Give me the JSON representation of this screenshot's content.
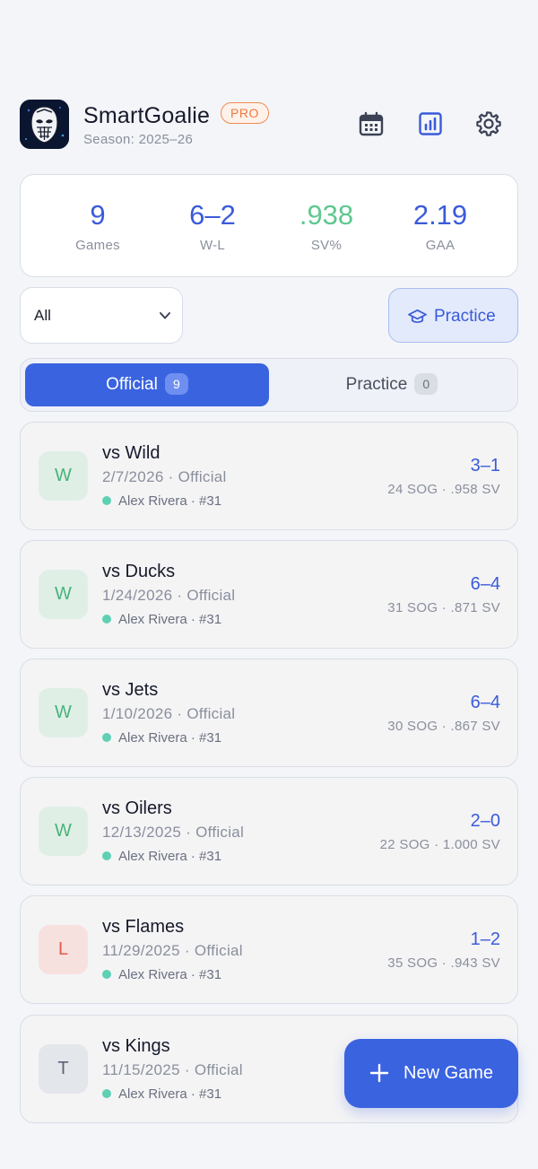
{
  "header": {
    "app_name": "SmartGoalie",
    "badge": "PRO",
    "season": "Season: 2025–26",
    "icons": [
      "calendar-icon",
      "bar-chart-icon",
      "gear-icon"
    ]
  },
  "stats": [
    {
      "value": "9",
      "label": "Games",
      "color": "#3a5bd9"
    },
    {
      "value": "6–2",
      "label": "W-L",
      "color": "#3a5bd9"
    },
    {
      "value": ".938",
      "label": "SV%",
      "color": "#5ec88f"
    },
    {
      "value": "2.19",
      "label": "GAA",
      "color": "#3a5bd9"
    }
  ],
  "filter": {
    "selected": "All",
    "practice_button": "Practice"
  },
  "tabs": [
    {
      "label": "Official",
      "count": "9",
      "active": true
    },
    {
      "label": "Practice",
      "count": "0",
      "active": false
    }
  ],
  "games": [
    {
      "result": "W",
      "opponent": "vs Wild",
      "meta": "2/7/2026 · Official",
      "goalie": "Alex Rivera · #31",
      "score": "3–1",
      "shots": "24 SOG · .958 SV"
    },
    {
      "result": "W",
      "opponent": "vs Ducks",
      "meta": "1/24/2026 · Official",
      "goalie": "Alex Rivera · #31",
      "score": "6–4",
      "shots": "31 SOG · .871 SV"
    },
    {
      "result": "W",
      "opponent": "vs Jets",
      "meta": "1/10/2026 · Official",
      "goalie": "Alex Rivera · #31",
      "score": "6–4",
      "shots": "30 SOG · .867 SV"
    },
    {
      "result": "W",
      "opponent": "vs Oilers",
      "meta": "12/13/2025 · Official",
      "goalie": "Alex Rivera · #31",
      "score": "2–0",
      "shots": "22 SOG · 1.000 SV"
    },
    {
      "result": "L",
      "opponent": "vs Flames",
      "meta": "11/29/2025 · Official",
      "goalie": "Alex Rivera · #31",
      "score": "1–2",
      "shots": "35 SOG · .943 SV"
    },
    {
      "result": "T",
      "opponent": "vs Kings",
      "meta": "11/15/2025 · Official",
      "goalie": "Alex Rivera · #31",
      "score": "",
      "shots": ""
    }
  ],
  "fab": {
    "label": "New Game"
  },
  "colors": {
    "accent": "#3a63e0",
    "win": "#48b27a",
    "loss": "#e05a4e",
    "tie": "#5d6474",
    "pro": "#ee7a3d"
  }
}
